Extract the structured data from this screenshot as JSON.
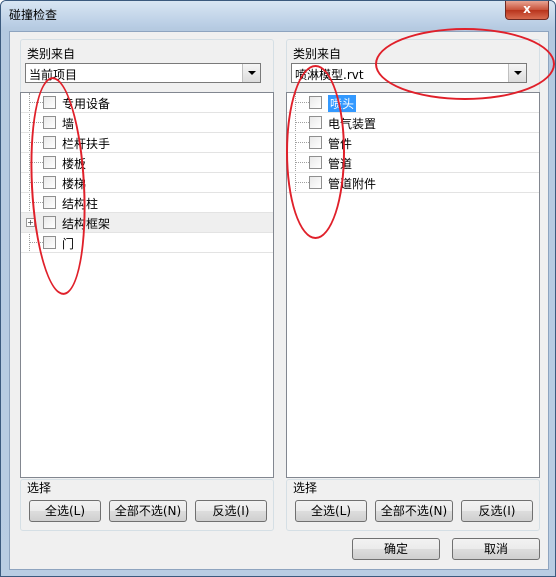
{
  "window": {
    "title": "碰撞检查",
    "close_glyph": "x"
  },
  "left": {
    "source_label": "类别来自",
    "source_value": "当前项目",
    "items": [
      {
        "label": "专用设备"
      },
      {
        "label": "墙"
      },
      {
        "label": "栏杆扶手"
      },
      {
        "label": "楼板"
      },
      {
        "label": "楼梯"
      },
      {
        "label": "结构柱"
      },
      {
        "label": "结构框架"
      },
      {
        "label": "门"
      }
    ],
    "select_group_label": "选择",
    "select_all": "全选(L)",
    "select_none": "全部不选(N)",
    "invert": "反选(I)"
  },
  "right": {
    "source_label": "类别来自",
    "source_value": "喷淋模型.rvt",
    "items": [
      {
        "label": "喷头"
      },
      {
        "label": "电气装置"
      },
      {
        "label": "管件"
      },
      {
        "label": "管道"
      },
      {
        "label": "管道附件"
      }
    ],
    "select_group_label": "选择",
    "select_all": "全选(L)",
    "select_none": "全部不选(N)",
    "invert": "反选(I)"
  },
  "footer": {
    "ok": "确定",
    "cancel": "取消"
  },
  "colors": {
    "selection": "#3399ff",
    "annotation": "#e0202a",
    "title_bar": "#b7cce3"
  }
}
